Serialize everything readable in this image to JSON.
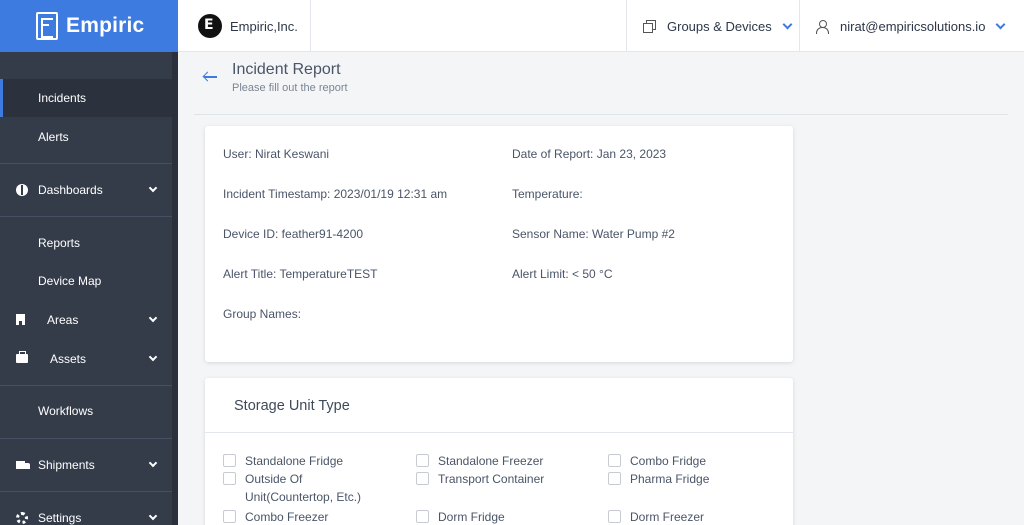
{
  "brand": {
    "name": "Empiric"
  },
  "org": {
    "name": "Empiric,Inc."
  },
  "header": {
    "groups_label": "Groups & Devices",
    "user_email": "nirat@empiricsolutions.io"
  },
  "sidebar": {
    "items": [
      {
        "label": "Incidents",
        "active": true
      },
      {
        "label": "Alerts"
      },
      {
        "label": "Dashboards",
        "icon": "dashboard-icon"
      },
      {
        "label": "Reports"
      },
      {
        "label": "Device Map"
      },
      {
        "label": "Areas",
        "icon": "building-icon"
      },
      {
        "label": "Assets",
        "icon": "briefcase-icon"
      },
      {
        "label": "Workflows"
      },
      {
        "label": "Shipments",
        "icon": "truck-icon"
      },
      {
        "label": "Settings",
        "icon": "gear-icon"
      }
    ]
  },
  "page": {
    "title": "Incident Report",
    "subtitle": "Please fill out the report"
  },
  "report": {
    "user": "User: Nirat Keswani",
    "date": "Date of Report: Jan 23, 2023",
    "timestamp": "Incident Timestamp: 2023/01/19 12:31 am",
    "temperature": "Temperature:",
    "device_id": "Device ID: feather91-4200",
    "sensor_name": "Sensor Name: Water Pump #2",
    "alert_title": "Alert Title: TemperatureTEST",
    "alert_limit": "Alert Limit: < 50 °C",
    "group_names": "Group Names:"
  },
  "storage": {
    "title": "Storage Unit Type",
    "options": [
      "Standalone Fridge",
      "Standalone Freezer",
      "Combo Fridge",
      "Outside Of Unit(Countertop, Etc.)",
      "Transport Container",
      "Pharma Fridge",
      "Combo Freezer",
      "Dorm Fridge",
      "Dorm Freezer"
    ]
  },
  "colors": {
    "brand": "#3d7be0",
    "sidebar": "#343c4a"
  }
}
